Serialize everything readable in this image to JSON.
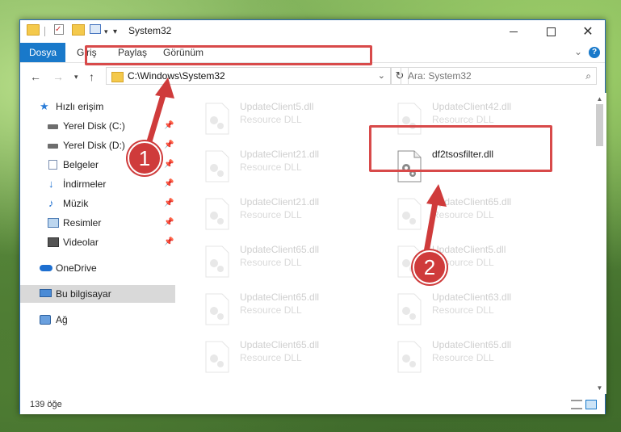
{
  "window": {
    "title": "System32"
  },
  "ribbon": {
    "tabs": [
      "Dosya",
      "Giriş",
      "Paylaş",
      "Görünüm"
    ],
    "help": "?"
  },
  "nav": {
    "address": "C:\\Windows\\System32",
    "search_placeholder": "Ara: System32"
  },
  "sidebar": {
    "quick_access": "Hızlı erişim",
    "items": [
      {
        "label": "Yerel Disk (C:)",
        "icon": "drive-icon",
        "pinned": true
      },
      {
        "label": "Yerel Disk (D:)",
        "icon": "drive-icon",
        "pinned": true
      },
      {
        "label": "Belgeler",
        "icon": "documents-icon",
        "pinned": true
      },
      {
        "label": "İndirmeler",
        "icon": "downloads-icon",
        "pinned": true
      },
      {
        "label": "Müzik",
        "icon": "music-icon",
        "pinned": true
      },
      {
        "label": "Resimler",
        "icon": "pictures-icon",
        "pinned": true
      },
      {
        "label": "Videolar",
        "icon": "videos-icon",
        "pinned": true
      }
    ],
    "onedrive": "OneDrive",
    "this_pc": "Bu bilgisayar",
    "network": "Ağ"
  },
  "files": {
    "left": [
      {
        "name": "UpdateClient5.dll",
        "type": "Resource DLL"
      },
      {
        "name": "UpdateClient21.dll",
        "type": "Resource DLL"
      },
      {
        "name": "UpdateClient21.dll",
        "type": "Resource DLL"
      },
      {
        "name": "UpdateClient65.dll",
        "type": "Resource DLL"
      },
      {
        "name": "UpdateClient65.dll",
        "type": "Resource DLL"
      },
      {
        "name": "UpdateClient65.dll",
        "type": "Resource DLL"
      }
    ],
    "right": [
      {
        "name": "UpdateClient42.dll",
        "type": "Resource DLL"
      },
      {
        "name": "df2tsosfilter.dll",
        "type": ""
      },
      {
        "name": "UpdateClient65.dll",
        "type": "Resource DLL"
      },
      {
        "name": "UpdateClient5.dll",
        "type": "Resource DLL"
      },
      {
        "name": "UpdateClient63.dll",
        "type": "Resource DLL"
      },
      {
        "name": "UpdateClient65.dll",
        "type": "Resource DLL"
      }
    ]
  },
  "status": {
    "count": "139 öğe"
  },
  "callouts": [
    "1",
    "2"
  ],
  "colors": {
    "accent": "#1979ca",
    "highlight": "#d84a4a"
  }
}
